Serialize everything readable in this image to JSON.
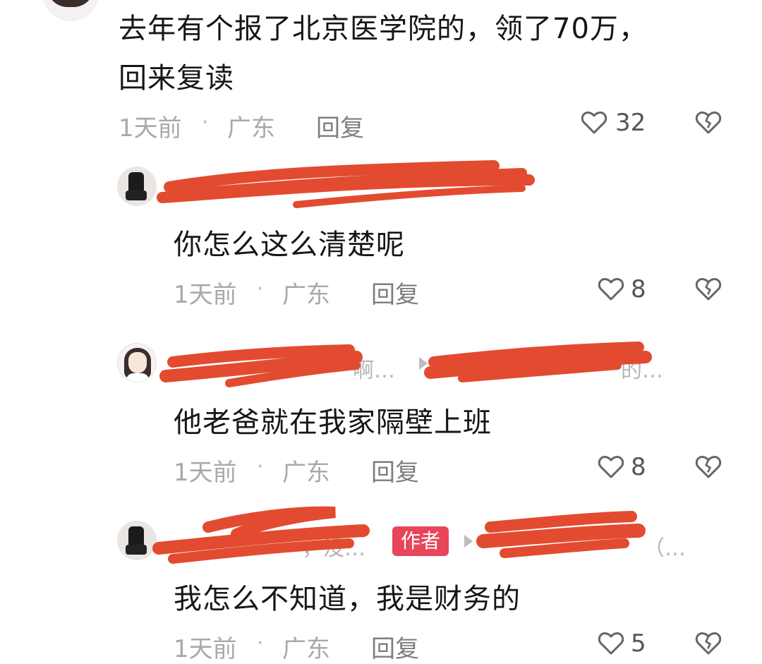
{
  "comments": [
    {
      "text": "去年有个报了北京医学院的，领了70万，",
      "text_line2": "回来复读",
      "time": "1天前",
      "location": "广东",
      "reply_label": "回复",
      "likes": "32"
    },
    {
      "text": "你怎么这么清楚呢",
      "time": "1天前",
      "location": "广东",
      "reply_label": "回复",
      "likes": "8"
    },
    {
      "text": "他老爸就在我家隔壁上班",
      "time": "1天前",
      "location": "广东",
      "reply_label": "回复",
      "likes": "8"
    },
    {
      "text": "我怎么不知道，我是财务的",
      "time": "1天前",
      "location": "广东",
      "reply_label": "回复",
      "likes": "5",
      "author_badge": "作者",
      "name_tail": "，没…",
      "reply_to_tail": "（…"
    }
  ],
  "sub2": {
    "name_tail": "啊…",
    "reply_to_tail": "的…"
  },
  "icons": {
    "like": "heart-outline-icon",
    "dislike": "broken-heart-icon"
  },
  "colors": {
    "redaction": "#e24b30",
    "badge": "#e8455b"
  }
}
